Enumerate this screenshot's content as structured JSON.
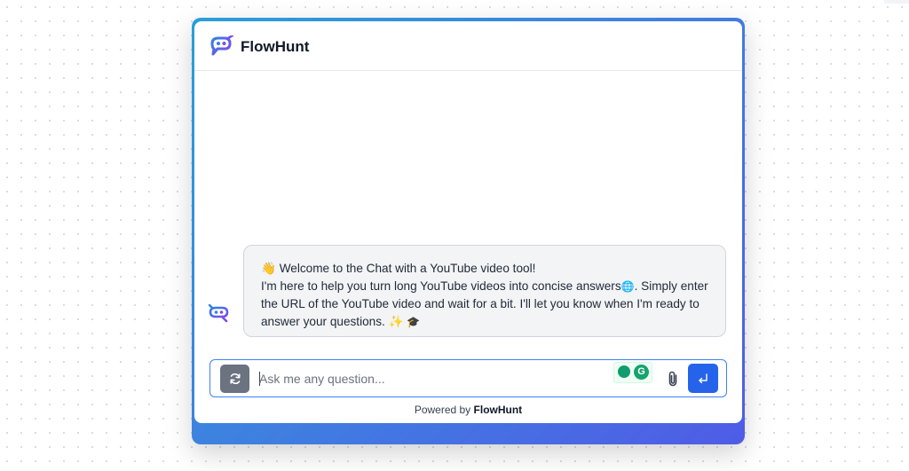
{
  "header": {
    "brand_name": "FlowHunt",
    "logo_icon": "flowhunt-logo-icon"
  },
  "chat": {
    "welcome_line": "👋 Welcome to the Chat with a YouTube video tool!",
    "body_text_1": "I'm here to help you turn long YouTube videos into concise answers",
    "globe_emoji": "🌐",
    "body_text_2": ". Simply enter the URL of the YouTube video and wait for a bit. I'll let you know when I'm ready to answer your questions. ✨",
    "hat_emoji": "🎓",
    "avatar_icon": "flowhunt-bot-icon"
  },
  "input": {
    "placeholder": "Ask me any question...",
    "value": "",
    "reset_icon": "refresh-icon",
    "attach_icon": "paperclip-icon",
    "send_icon": "enter-return-icon",
    "extension_letter": "G"
  },
  "footer": {
    "powered_prefix": "Powered by",
    "powered_brand": "FlowHunt"
  },
  "colors": {
    "gradient_start": "#2a9fd8",
    "gradient_end": "#4f5ce6",
    "send_button": "#2563eb",
    "reset_button": "#6b7280",
    "bubble_bg": "#f3f4f6"
  }
}
